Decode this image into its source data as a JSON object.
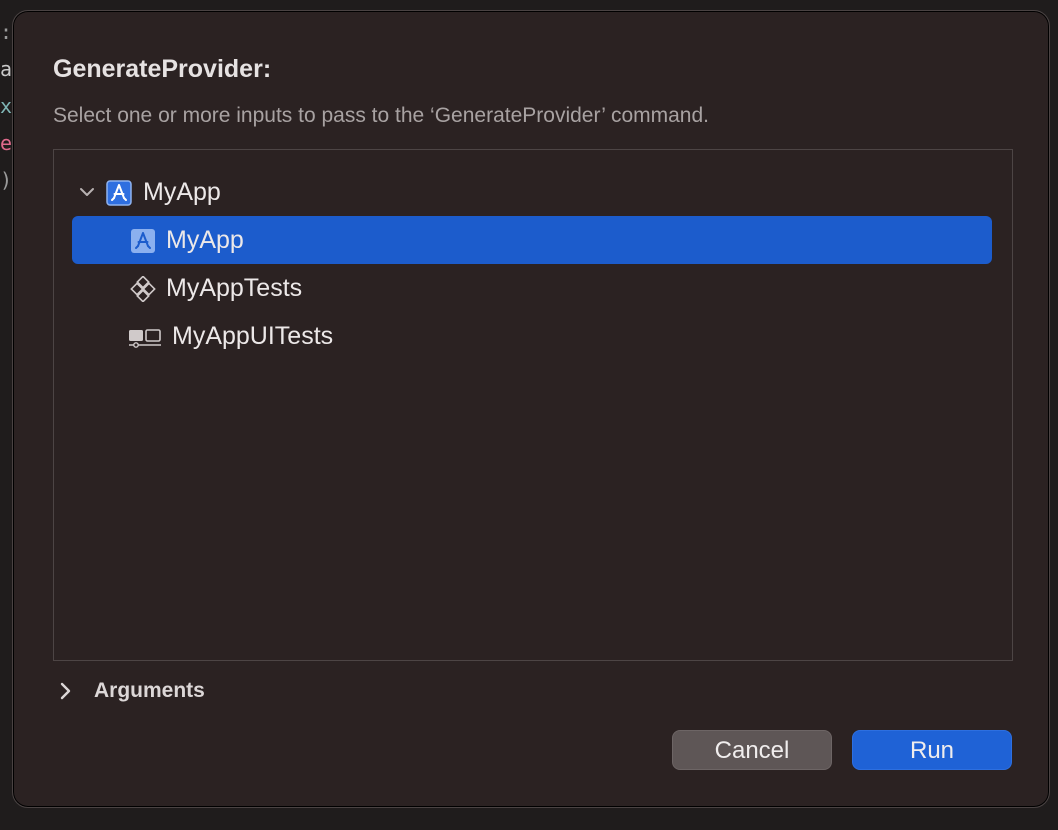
{
  "background": {
    "glyphs": [
      {
        "char": ":",
        "color": "#9b9b9b"
      },
      {
        "char": "a",
        "color": "#c9c9c9"
      },
      {
        "char": "x",
        "color": "#7fb5b5"
      },
      {
        "char": "e",
        "color": "#e06a8c"
      },
      {
        "char": ")",
        "color": "#9b9b9b"
      }
    ]
  },
  "dialog": {
    "title": "GenerateProvider:",
    "subtitle": "Select one or more inputs to pass to the ‘GenerateProvider’ command.",
    "tree": {
      "root": {
        "label": "MyApp",
        "icon": "app-project-icon",
        "expanded": true
      },
      "items": [
        {
          "label": "MyApp",
          "icon": "app-target-icon",
          "selected": true
        },
        {
          "label": "MyAppTests",
          "icon": "unit-test-icon",
          "selected": false
        },
        {
          "label": "MyAppUITests",
          "icon": "ui-test-icon",
          "selected": false
        }
      ]
    },
    "arguments_label": "Arguments",
    "buttons": {
      "cancel": "Cancel",
      "run": "Run"
    }
  },
  "colors": {
    "accent": "#1c5ccc",
    "dialog_bg": "#2b2222",
    "button_gray": "#5e5656"
  }
}
